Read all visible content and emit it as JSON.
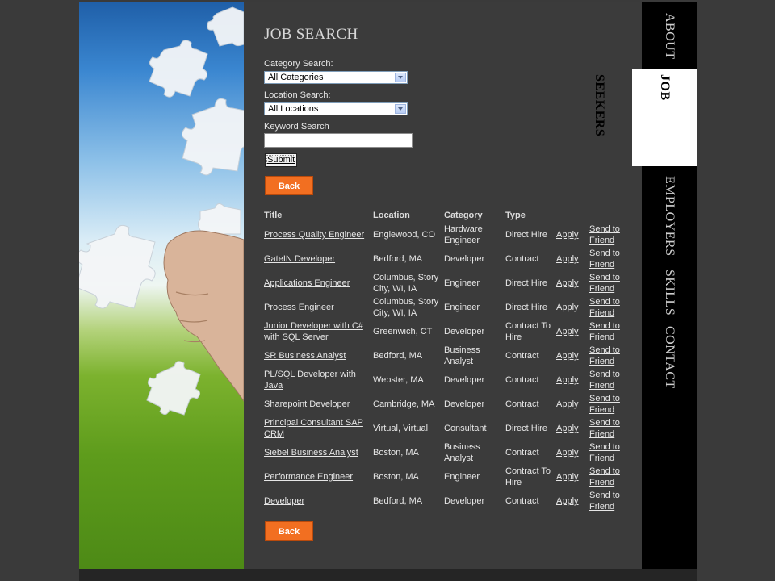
{
  "page": {
    "title": "JOB SEARCH"
  },
  "search": {
    "category_label": "Category Search:",
    "category_value": "All Categories",
    "location_label": "Location Search:",
    "location_value": "All Locations",
    "keyword_label": "Keyword Search",
    "keyword_value": "",
    "submit_label": "Submit",
    "back_label": "Back"
  },
  "table": {
    "headers": [
      "Title",
      "Location",
      "Category",
      "Type"
    ],
    "apply_label": "Apply",
    "send_label_1": "Send to",
    "send_label_2": "Friend",
    "rows": [
      {
        "title": "Process Quality Engineer",
        "location": "Englewood, CO",
        "category": "Hardware Engineer",
        "type": "Direct Hire"
      },
      {
        "title": "GateIN Developer",
        "location": "Bedford, MA",
        "category": "Developer",
        "type": "Contract"
      },
      {
        "title": "Applications Engineer",
        "location": "Columbus, Story City, WI, IA",
        "category": "Engineer",
        "type": "Direct Hire"
      },
      {
        "title": "Process Engineer",
        "location": "Columbus, Story City, WI, IA",
        "category": "Engineer",
        "type": "Direct Hire"
      },
      {
        "title": "Junior Developer with C# with SQL Server",
        "location": "Greenwich, CT",
        "category": "Developer",
        "type": "Contract To Hire"
      },
      {
        "title": "SR Business Analyst",
        "location": "Bedford, MA",
        "category": "Business Analyst",
        "type": "Contract"
      },
      {
        "title": "PL/SQL Developer with Java",
        "location": "Webster, MA",
        "category": "Developer",
        "type": "Contract"
      },
      {
        "title": "Sharepoint Developer",
        "location": "Cambridge, MA",
        "category": "Developer",
        "type": "Contract"
      },
      {
        "title": "Principal Consultant SAP CRM",
        "location": "Virtual, Virtual",
        "category": "Consultant",
        "type": "Direct Hire"
      },
      {
        "title": "Siebel Business Analyst",
        "location": "Boston, MA",
        "category": "Business Analyst",
        "type": "Contract"
      },
      {
        "title": "Performance Engineer",
        "location": "Boston, MA",
        "category": "Engineer",
        "type": "Contract To Hire"
      },
      {
        "title": "Developer",
        "location": "Bedford, MA",
        "category": "Developer",
        "type": "Contract"
      }
    ]
  },
  "nav": {
    "about": "ABOUT",
    "job_seekers": "JOB SEEKERS",
    "employers": "EMPLOYERS",
    "skills": "SKILLS",
    "contact": "CONTACT"
  },
  "colors": {
    "accent": "#f26f21",
    "background": "#3b3b3b",
    "nav": "#000000"
  }
}
